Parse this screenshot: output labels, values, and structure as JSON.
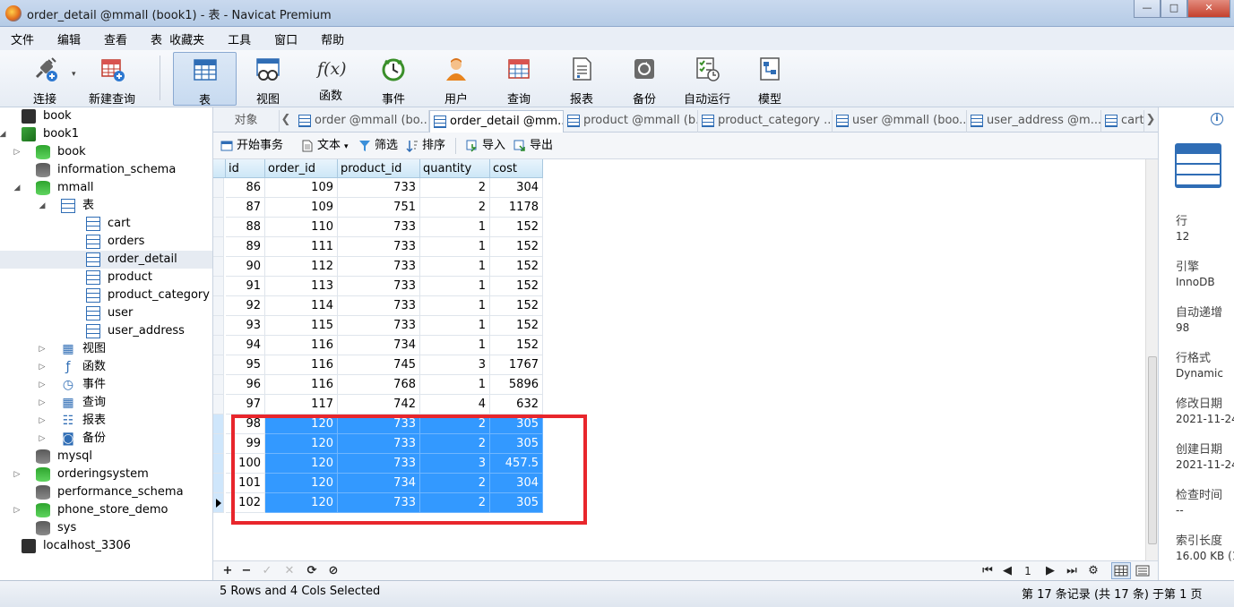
{
  "window": {
    "title": "order_detail @mmall (book1) - 表 - Navicat Premium",
    "buttons": [
      "—",
      "□",
      "✕"
    ]
  },
  "menu": [
    "文件",
    "编辑",
    "查看",
    "表",
    "收藏夹",
    "工具",
    "窗口",
    "帮助"
  ],
  "toolbar": {
    "items": [
      {
        "label": "连接",
        "icon": "plug-icon"
      },
      {
        "label": "新建查询",
        "icon": "new-query-icon"
      },
      {
        "label": "表",
        "icon": "table-icon",
        "active": true
      },
      {
        "label": "视图",
        "icon": "view-icon"
      },
      {
        "label": "函数",
        "icon": "function-icon"
      },
      {
        "label": "事件",
        "icon": "clock-icon"
      },
      {
        "label": "用户",
        "icon": "user-icon"
      },
      {
        "label": "查询",
        "icon": "query-icon"
      },
      {
        "label": "报表",
        "icon": "report-icon"
      },
      {
        "label": "备份",
        "icon": "backup-icon"
      },
      {
        "label": "自动运行",
        "icon": "schedule-icon"
      },
      {
        "label": "模型",
        "icon": "model-icon"
      }
    ],
    "func_glyph": "f(x)"
  },
  "sidebar": {
    "items": [
      {
        "label": "book",
        "icon": "connection-icon",
        "toggle": "",
        "depth": 0
      },
      {
        "label": "book1",
        "icon": "connection-open-icon",
        "toggle": "◢",
        "depth": 0
      },
      {
        "label": "book",
        "icon": "database-green-icon",
        "toggle": "▷",
        "depth": 1
      },
      {
        "label": "information_schema",
        "icon": "database-gray-icon",
        "toggle": "",
        "depth": 1
      },
      {
        "label": "mmall",
        "icon": "database-green-icon",
        "toggle": "◢",
        "depth": 1
      },
      {
        "label": "表",
        "icon": "tables-folder-icon",
        "toggle": "◢",
        "depth": 2
      },
      {
        "label": "cart",
        "icon": "table-icon",
        "toggle": "",
        "depth": 3
      },
      {
        "label": "orders",
        "icon": "table-icon",
        "toggle": "",
        "depth": 3
      },
      {
        "label": "order_detail",
        "icon": "table-icon",
        "toggle": "",
        "depth": 3,
        "selected": true
      },
      {
        "label": "product",
        "icon": "table-icon",
        "toggle": "",
        "depth": 3
      },
      {
        "label": "product_category",
        "icon": "table-icon",
        "toggle": "",
        "depth": 3
      },
      {
        "label": "user",
        "icon": "table-icon",
        "toggle": "",
        "depth": 3
      },
      {
        "label": "user_address",
        "icon": "table-icon",
        "toggle": "",
        "depth": 3
      },
      {
        "label": "视图",
        "icon": "view-icon",
        "toggle": "▷",
        "depth": 2
      },
      {
        "label": "函数",
        "icon": "function-icon",
        "toggle": "▷",
        "depth": 2
      },
      {
        "label": "事件",
        "icon": "clock-icon",
        "toggle": "▷",
        "depth": 2
      },
      {
        "label": "查询",
        "icon": "query-icon",
        "toggle": "▷",
        "depth": 2
      },
      {
        "label": "报表",
        "icon": "report-icon",
        "toggle": "▷",
        "depth": 2
      },
      {
        "label": "备份",
        "icon": "backup-icon",
        "toggle": "▷",
        "depth": 2
      },
      {
        "label": "mysql",
        "icon": "database-gray-icon",
        "toggle": "",
        "depth": 1
      },
      {
        "label": "orderingsystem",
        "icon": "database-green-icon",
        "toggle": "▷",
        "depth": 1
      },
      {
        "label": "performance_schema",
        "icon": "database-gray-icon",
        "toggle": "",
        "depth": 1
      },
      {
        "label": "phone_store_demo",
        "icon": "database-green-icon",
        "toggle": "▷",
        "depth": 1
      },
      {
        "label": "sys",
        "icon": "database-gray-icon",
        "toggle": "",
        "depth": 1
      },
      {
        "label": "localhost_3306",
        "icon": "connection-icon",
        "toggle": "",
        "depth": 0
      }
    ]
  },
  "tabs": {
    "objects_label": "对象",
    "items": [
      {
        "label": "order @mmall (bo...",
        "active": false
      },
      {
        "label": "order_detail @mm...",
        "active": true
      },
      {
        "label": "product @mmall (b...",
        "active": false
      },
      {
        "label": "product_category ...",
        "active": false
      },
      {
        "label": "user @mmall (boo...",
        "active": false
      },
      {
        "label": "user_address @m...",
        "active": false
      },
      {
        "label": "cart",
        "active": false
      }
    ],
    "arrow_left": "❮",
    "arrow_right": "❯"
  },
  "subtoolbar": {
    "begin_transaction": "开始事务",
    "text": "文本",
    "filter": "筛选",
    "sort": "排序",
    "import": "导入",
    "export": "导出"
  },
  "grid": {
    "columns": [
      "id",
      "order_id",
      "product_id",
      "quantity",
      "cost"
    ],
    "rows": [
      {
        "id": "86",
        "order_id": "109",
        "product_id": "733",
        "quantity": "2",
        "cost": "304"
      },
      {
        "id": "87",
        "order_id": "109",
        "product_id": "751",
        "quantity": "2",
        "cost": "1178"
      },
      {
        "id": "88",
        "order_id": "110",
        "product_id": "733",
        "quantity": "1",
        "cost": "152"
      },
      {
        "id": "89",
        "order_id": "111",
        "product_id": "733",
        "quantity": "1",
        "cost": "152"
      },
      {
        "id": "90",
        "order_id": "112",
        "product_id": "733",
        "quantity": "1",
        "cost": "152"
      },
      {
        "id": "91",
        "order_id": "113",
        "product_id": "733",
        "quantity": "1",
        "cost": "152"
      },
      {
        "id": "92",
        "order_id": "114",
        "product_id": "733",
        "quantity": "1",
        "cost": "152"
      },
      {
        "id": "93",
        "order_id": "115",
        "product_id": "733",
        "quantity": "1",
        "cost": "152"
      },
      {
        "id": "94",
        "order_id": "116",
        "product_id": "734",
        "quantity": "1",
        "cost": "152"
      },
      {
        "id": "95",
        "order_id": "116",
        "product_id": "745",
        "quantity": "3",
        "cost": "1767"
      },
      {
        "id": "96",
        "order_id": "116",
        "product_id": "768",
        "quantity": "1",
        "cost": "5896"
      },
      {
        "id": "97",
        "order_id": "117",
        "product_id": "742",
        "quantity": "4",
        "cost": "632"
      },
      {
        "id": "98",
        "order_id": "120",
        "product_id": "733",
        "quantity": "2",
        "cost": "305",
        "selected": true
      },
      {
        "id": "99",
        "order_id": "120",
        "product_id": "733",
        "quantity": "2",
        "cost": "305",
        "selected": true
      },
      {
        "id": "100",
        "order_id": "120",
        "product_id": "733",
        "quantity": "3",
        "cost": "457.5",
        "selected": true
      },
      {
        "id": "101",
        "order_id": "120",
        "product_id": "734",
        "quantity": "2",
        "cost": "304",
        "selected": true
      },
      {
        "id": "102",
        "order_id": "120",
        "product_id": "733",
        "quantity": "2",
        "cost": "305",
        "selected": true,
        "current": true
      }
    ],
    "selection_color": "#3399ff",
    "highlight_color": "#e8262c"
  },
  "grid_nav": {
    "buttons_left": [
      "+",
      "−",
      "✓",
      "✕",
      "⟳",
      "⊘"
    ],
    "page": "1",
    "buttons_right": [
      "⏮",
      "◀",
      "▶",
      "⏭",
      "⚙"
    ]
  },
  "status": {
    "selection": "5 Rows and 4 Cols Selected",
    "record": "第 17 条记录 (共 17 条) 于第 1 页"
  },
  "info_panel": {
    "info_glyph": "i",
    "fields": [
      {
        "label": "行",
        "value": "12"
      },
      {
        "label": "引擎",
        "value": "InnoDB"
      },
      {
        "label": "自动递增",
        "value": "98"
      },
      {
        "label": "行格式",
        "value": "Dynamic"
      },
      {
        "label": "修改日期",
        "value": "2021-11-24"
      },
      {
        "label": "创建日期",
        "value": "2021-11-24"
      },
      {
        "label": "检查时间",
        "value": "--"
      },
      {
        "label": "索引长度",
        "value": "16.00 KB (1"
      }
    ]
  }
}
